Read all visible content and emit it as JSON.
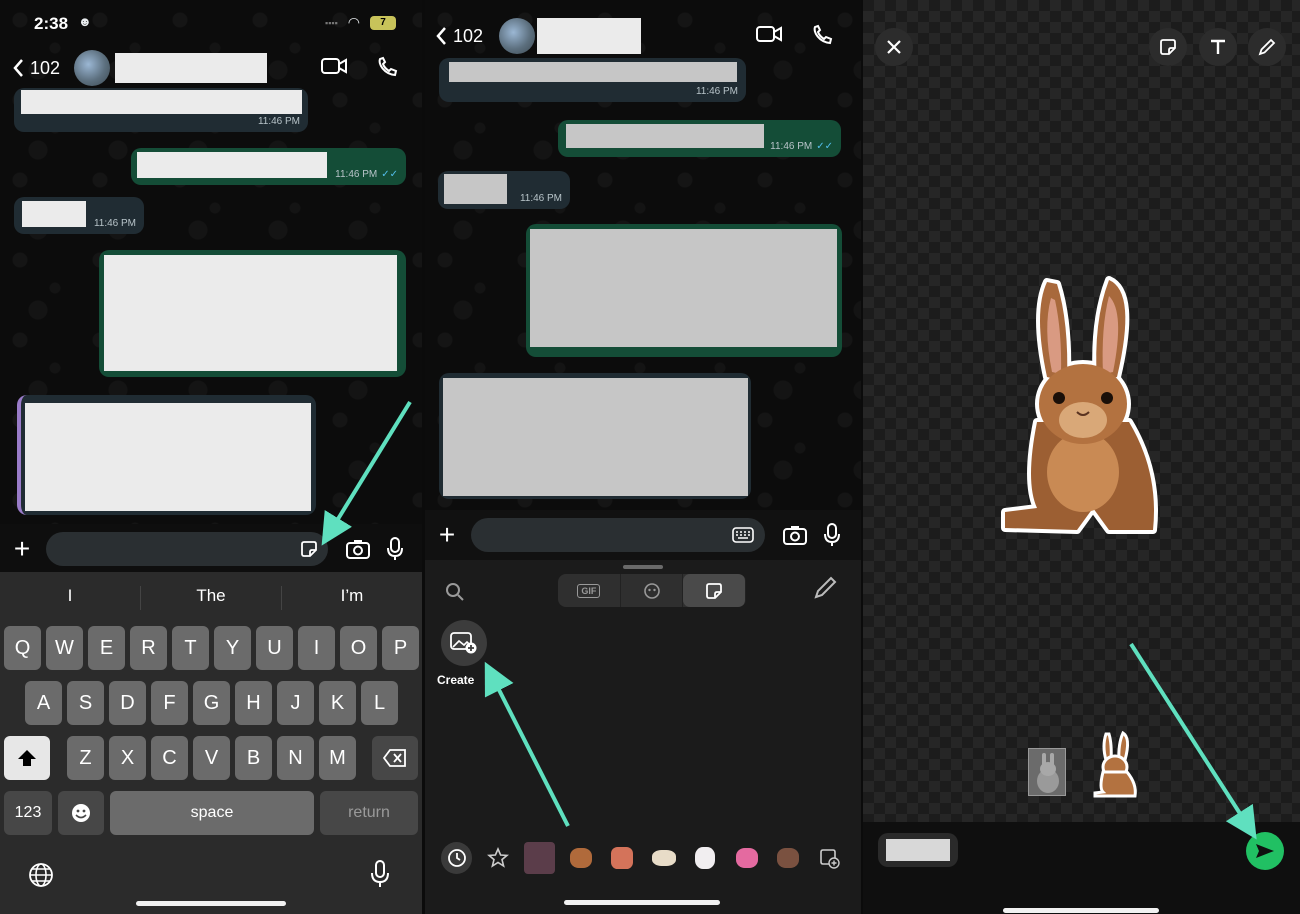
{
  "status": {
    "time": "2:38",
    "battery": "7"
  },
  "chat": {
    "back_count": "102",
    "messages": [
      {
        "time": "11:46 PM"
      },
      {
        "time": "11:46 PM"
      },
      {
        "time": "11:46 PM"
      }
    ]
  },
  "keyboard": {
    "suggestions": [
      "I",
      "The",
      "I’m"
    ],
    "row1": [
      "Q",
      "W",
      "E",
      "R",
      "T",
      "Y",
      "U",
      "I",
      "O",
      "P"
    ],
    "row2": [
      "A",
      "S",
      "D",
      "F",
      "G",
      "H",
      "J",
      "K",
      "L"
    ],
    "row3": [
      "Z",
      "X",
      "C",
      "V",
      "B",
      "N",
      "M"
    ],
    "numbers_label": "123",
    "space_label": "space",
    "return_label": "return"
  },
  "stickers": {
    "tab_gif": "GIF",
    "create_label": "Create"
  },
  "colors": {
    "accent_arrow": "#5fe0bf",
    "send_green": "#21c063",
    "out_bubble": "#144d37"
  }
}
